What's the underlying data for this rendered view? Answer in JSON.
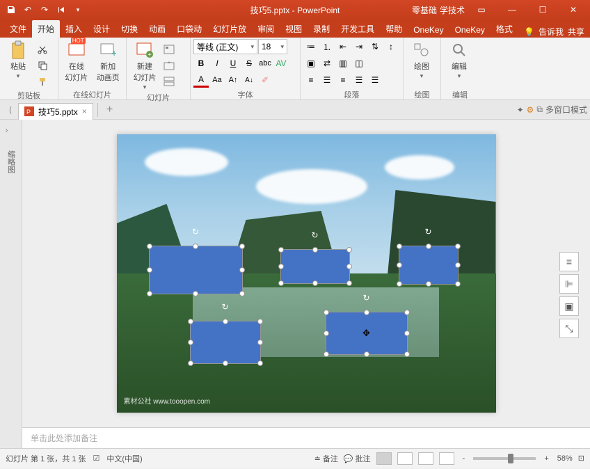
{
  "titlebar": {
    "filename": "技巧5.pptx",
    "app": "PowerPoint",
    "right_text1": "零基础",
    "right_text2": "学技术"
  },
  "tabs": {
    "items": [
      "文件",
      "开始",
      "插入",
      "设计",
      "切换",
      "动画",
      "口袋动",
      "幻灯片放",
      "审阅",
      "视图",
      "录制",
      "开发工具",
      "帮助",
      "OneKey",
      "OneKey",
      "格式"
    ],
    "active_index": 1,
    "tell_me": "告诉我",
    "share": "共享"
  },
  "ribbon": {
    "clipboard": {
      "paste": "粘贴",
      "label": "剪贴板"
    },
    "online": {
      "online_slides": "在线\n幻灯片",
      "new_anim": "新加\n动画页",
      "label": "在线幻灯片"
    },
    "slides": {
      "new_slide": "新建\n幻灯片",
      "label": "幻灯片"
    },
    "font": {
      "font_name": "等线 (正文)",
      "font_size": "18",
      "label": "字体"
    },
    "paragraph": {
      "label": "段落"
    },
    "drawing": {
      "label": "绘图"
    },
    "editing": {
      "label": "编辑"
    }
  },
  "filetab": {
    "name": "技巧5.pptx",
    "multiwindow": "多窗口模式"
  },
  "sidestrip": {
    "label": "缩略图"
  },
  "notes_placeholder": "单击此处添加备注",
  "statusbar": {
    "slide_info": "幻灯片 第 1 张，共 1 张",
    "lang": "中文(中国)",
    "notes_btn": "备注",
    "comments_btn": "批注",
    "zoom_out": "-",
    "zoom_in": "+",
    "zoom_pct": "58%"
  },
  "watermark": "素材公社 www.tooopen.com"
}
